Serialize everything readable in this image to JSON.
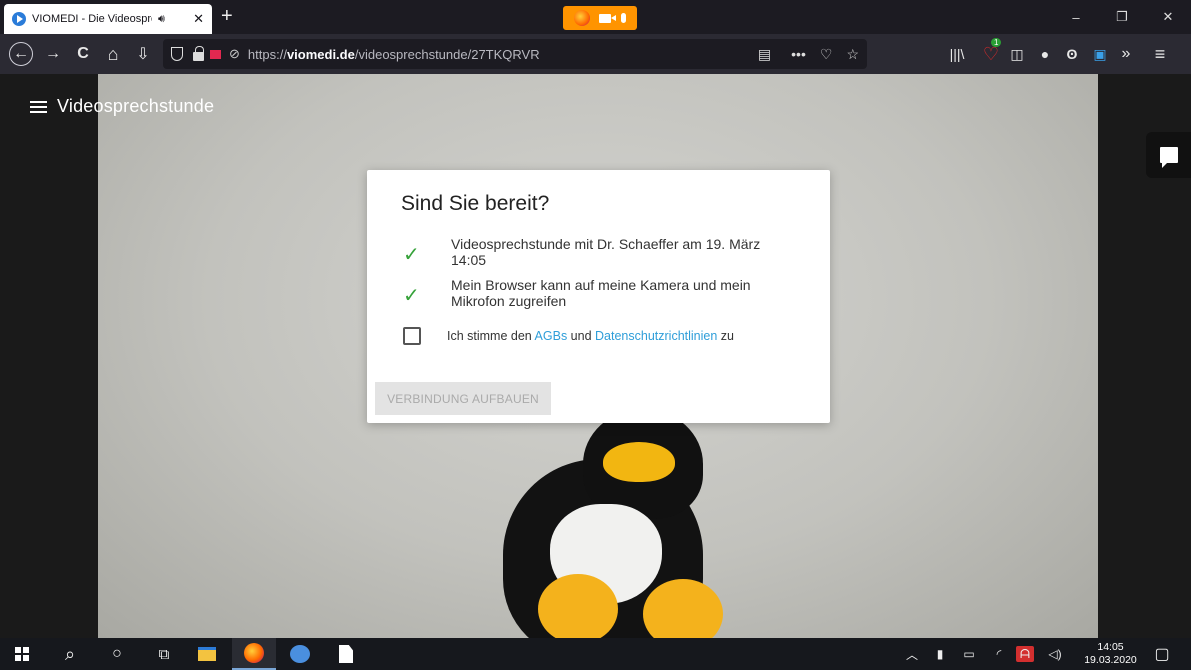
{
  "browser": {
    "tab": {
      "title": "VIOMEDI - Die Videosprechstunde",
      "audio_icon": "speaker-icon",
      "close": "✕"
    },
    "new_tab": "+",
    "sharing_indicator": [
      "firefox-icon",
      "camera-icon",
      "microphone-icon"
    ],
    "window_controls": {
      "minimize": "–",
      "restore": "❐",
      "close": "✕"
    },
    "nav": {
      "back": "←",
      "forward": "→",
      "reload": "C",
      "home": "⌂",
      "download": "⇩"
    },
    "url": {
      "prefix": "https://",
      "domain": "viomedi.de",
      "path": "/videosprechstunde/27TKQRVR"
    },
    "url_icons": {
      "reader": "▤",
      "more": "•••",
      "pocket": "♡",
      "bookmark": "☆"
    },
    "toolbar": {
      "library": "|||\\",
      "addon_badge": "1",
      "sidebar": "◫",
      "overflow": "»",
      "menu": "≡"
    }
  },
  "app": {
    "menu_icon": "hamburger-icon",
    "title": "Videosprechstunde",
    "chat_icon": "chat-icon"
  },
  "dialog": {
    "title": "Sind Sie bereit?",
    "checks": [
      "Videosprechstunde mit Dr. Schaeffer am 19. März 14:05",
      "Mein Browser kann auf meine Kamera und mein Mikrofon zugreifen"
    ],
    "consent": {
      "before": "Ich stimme den ",
      "agb_link": "AGBs",
      "middle": " und ",
      "privacy_link": "Datenschutzrichtlinien",
      "after": " zu",
      "checked": false
    },
    "connect_button": "VERBINDUNG AUFBAUEN"
  },
  "colors": {
    "check_green": "#36a23a",
    "link_blue": "#2f9ed9",
    "recording_red": "#e22850",
    "sharing_orange": "#ff9400"
  },
  "taskbar": {
    "search_icon": "⌕",
    "cortana_icon": "○",
    "taskview_icon": "⧉",
    "clock": {
      "time": "14:05",
      "date": "19.03.2020"
    }
  }
}
